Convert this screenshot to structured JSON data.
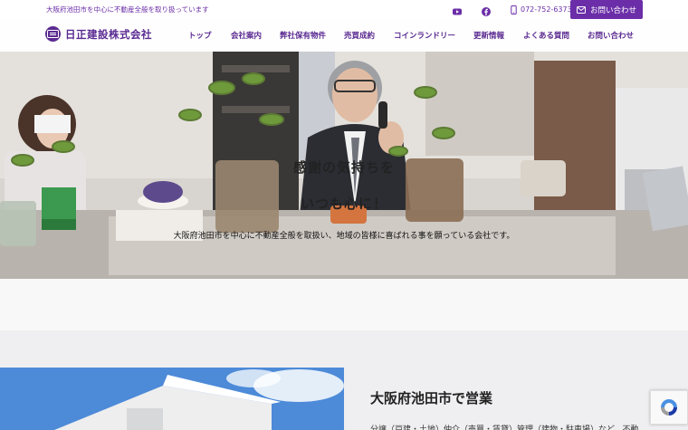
{
  "topbar": {
    "tagline": "大阪府池田市を中心に不動産全般を取り扱っています",
    "phone": "072-752-6373",
    "contact_label": "お問い合わせ"
  },
  "header": {
    "company_name": "日正建設株式会社",
    "nav": [
      "トップ",
      "会社案内",
      "弊社保有物件",
      "売買成約",
      "コインランドリー",
      "更新情報",
      "よくある質問",
      "お問い合わせ"
    ]
  },
  "hero": {
    "title_line1": "感謝の気持ちを",
    "title_line2": "いつも心に！",
    "subtitle": "大阪府池田市を中心に不動産全般を取扱い、地域の皆様に喜ばれる事を願っている会社です。"
  },
  "section": {
    "title": "大阪府池田市で営業",
    "text": "分譲（戸建・土地）仲介（売買・賃貸）管理（建物・駐車場）など、不動"
  },
  "colors": {
    "brand_purple": "#6b2ea8",
    "nav_purple": "#5a2a91"
  },
  "icons": [
    "youtube-icon",
    "facebook-icon",
    "phone-icon",
    "mail-icon",
    "recaptcha-icon"
  ]
}
